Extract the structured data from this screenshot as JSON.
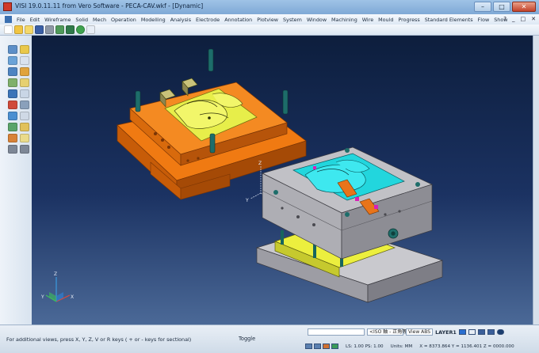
{
  "window": {
    "title": "VISI 19.0.11.11 from Vero Software - PECA-CAV.wkf - [Dynamic]",
    "minimize_glyph": "–",
    "maximize_glyph": "□",
    "close_glyph": "✕"
  },
  "menu": {
    "items": [
      "File",
      "Edit",
      "Wireframe",
      "Solid",
      "Mech",
      "Operation",
      "Modelling",
      "Analysis",
      "Electrode",
      "Annotation",
      "Plotview",
      "System",
      "Window",
      "Machining",
      "Wire",
      "Mould",
      "Progress",
      "Standard Elements",
      "Flow",
      "Show"
    ],
    "right": [
      "?",
      "_",
      "□",
      "✕"
    ]
  },
  "toolbar": {
    "icons": [
      "new-file-icon",
      "open-folder-icon",
      "open-wizard-icon",
      "save-icon",
      "print-icon",
      "import-icon",
      "export-icon",
      "globe-icon",
      "window-icon"
    ]
  },
  "left_panel": {
    "icons": [
      "select-icon",
      "edit-icon",
      "move-icon",
      "copy-icon",
      "rotate-icon",
      "mirror-icon",
      "scale-icon",
      "layer-icon",
      "measure-icon",
      "view-icon",
      "erase-icon",
      "hide-icon",
      "shade-icon",
      "wire-icon",
      "filter-icon",
      "paint-icon",
      "lock-icon",
      "unlock-icon",
      "back-arrow-icon",
      "forward-arrow-icon"
    ]
  },
  "viewport": {
    "axis_z": "Z",
    "axis_y": "Y",
    "axis_x": "X",
    "triad_x": "X",
    "triad_y": "Y",
    "triad_z": "Z"
  },
  "statusbar": {
    "hint": "For additional views, press X, Y, Z, V or R keys ( + or - keys for sectional)",
    "toggle": "Toggle",
    "view_label": "View ABS",
    "layer_label": "LAYER1",
    "projection": "<ISO 軸 - 正角等> ",
    "scale": "LS: 1.00  PS: 1.00",
    "units": "Units: MM",
    "coordinates": "X = 8373.864  Y = 1136.401  Z = 0000.000"
  },
  "colors": {
    "background_top": "#0d1e3d",
    "background_bottom": "#4b6997",
    "mold_orange": "#f07a12",
    "mold_gray": "#b8b8bd",
    "insert_yellow": "#e7ee4a",
    "cavity_cyan": "#22d6dd",
    "pillar_teal": "#1d6d6a"
  }
}
